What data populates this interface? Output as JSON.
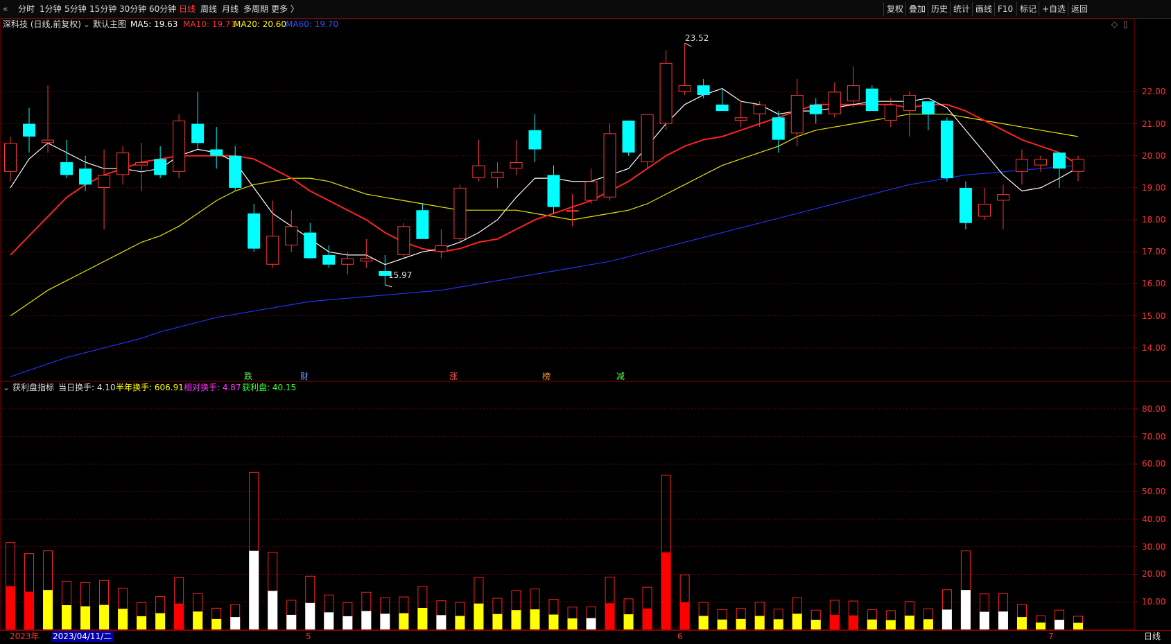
{
  "toolbar": {
    "collapse_icon": "double-chevron-left-icon",
    "periods": [
      "分时",
      "1分钟",
      "5分钟",
      "15分钟",
      "30分钟",
      "60分钟",
      "日线",
      "周线",
      "月线",
      "多周期",
      "更多 〉"
    ],
    "active_period": "日线",
    "right_buttons": [
      "复权",
      "叠加",
      "历史",
      "统计",
      "画线",
      "F10",
      "标记",
      "+自选",
      "返回"
    ]
  },
  "main_chart": {
    "title": "深科技 (日线,前复权)",
    "chart_icon": "circle-chevron-down-icon",
    "theme_label": "默认主图",
    "ma": [
      {
        "label": "MA5: 19.63",
        "color": "#ffffff"
      },
      {
        "label": "MA10: 19.71",
        "color": "#ff3333"
      },
      {
        "label": "MA20: 20.60",
        "color": "#ffff00"
      },
      {
        "label": "MA60: 19.70",
        "color": "#2244ff"
      }
    ],
    "right_icons": [
      "diamond-icon",
      "window-icon"
    ],
    "high_label": "23.52",
    "low_label": "15.97",
    "event_labels": [
      {
        "text": "跌",
        "color": "#55ff55"
      },
      {
        "text": "财",
        "color": "#6699ff"
      },
      {
        "text": "涨",
        "color": "#ff5555"
      },
      {
        "text": "榜",
        "color": "#ff9933"
      },
      {
        "text": "减",
        "color": "#55ff55"
      }
    ],
    "y_ticks": [
      "22.00",
      "21.00",
      "20.00",
      "19.00",
      "18.00",
      "17.00",
      "16.00",
      "15.00",
      "14.00"
    ]
  },
  "indicator": {
    "title": "获利盘指标",
    "stats": [
      {
        "label": "当日换手: 4.10",
        "color": "#dddddd"
      },
      {
        "label": "半年换手: 606.91",
        "color": "#ffff00"
      },
      {
        "label": "相对换手: 4.87",
        "color": "#ff33ff"
      },
      {
        "label": "获利盘: 40.15",
        "color": "#33ff33"
      }
    ],
    "y_ticks": [
      "80.00",
      "70.00",
      "60.00",
      "50.00",
      "40.00",
      "30.00",
      "20.00",
      "10.00"
    ]
  },
  "x_axis": {
    "year_label": "2023年",
    "date_label": "2023/04/11/二",
    "month_marks": [
      "5",
      "6",
      "7"
    ],
    "period_tab": "日线"
  },
  "chart_data": {
    "type": "candlestick",
    "candles": [
      {
        "o": 19.5,
        "h": 20.6,
        "l": 19.2,
        "c": 20.4
      },
      {
        "o": 21.0,
        "h": 21.5,
        "l": 20.1,
        "c": 20.6
      },
      {
        "o": 20.4,
        "h": 22.2,
        "l": 20.1,
        "c": 20.5
      },
      {
        "o": 19.8,
        "h": 20.5,
        "l": 19.3,
        "c": 19.4
      },
      {
        "o": 19.6,
        "h": 20.0,
        "l": 18.9,
        "c": 19.1
      },
      {
        "o": 19.0,
        "h": 20.2,
        "l": 17.7,
        "c": 19.4
      },
      {
        "o": 19.4,
        "h": 20.3,
        "l": 19.1,
        "c": 20.1
      },
      {
        "o": 19.7,
        "h": 20.4,
        "l": 18.9,
        "c": 19.8
      },
      {
        "o": 19.9,
        "h": 20.3,
        "l": 19.3,
        "c": 19.4
      },
      {
        "o": 19.5,
        "h": 21.3,
        "l": 19.3,
        "c": 21.1
      },
      {
        "o": 21.0,
        "h": 22.0,
        "l": 20.2,
        "c": 20.4
      },
      {
        "o": 20.2,
        "h": 20.9,
        "l": 19.6,
        "c": 20.0
      },
      {
        "o": 20.0,
        "h": 20.3,
        "l": 18.9,
        "c": 19.0
      },
      {
        "o": 18.2,
        "h": 18.5,
        "l": 17.0,
        "c": 17.1
      },
      {
        "o": 16.6,
        "h": 18.6,
        "l": 16.5,
        "c": 17.5
      },
      {
        "o": 17.2,
        "h": 18.3,
        "l": 17.0,
        "c": 17.8
      },
      {
        "o": 17.6,
        "h": 17.9,
        "l": 16.8,
        "c": 16.8
      },
      {
        "o": 16.9,
        "h": 17.2,
        "l": 16.5,
        "c": 16.6
      },
      {
        "o": 16.6,
        "h": 17.0,
        "l": 16.3,
        "c": 16.8
      },
      {
        "o": 16.7,
        "h": 17.4,
        "l": 16.5,
        "c": 16.8
      },
      {
        "o": 16.4,
        "h": 16.9,
        "l": 15.97,
        "c": 16.25
      },
      {
        "o": 16.9,
        "h": 17.9,
        "l": 16.8,
        "c": 17.8
      },
      {
        "o": 18.3,
        "h": 18.5,
        "l": 17.4,
        "c": 17.4
      },
      {
        "o": 17.0,
        "h": 17.7,
        "l": 16.8,
        "c": 17.2
      },
      {
        "o": 17.4,
        "h": 19.1,
        "l": 17.3,
        "c": 19.0
      },
      {
        "o": 19.3,
        "h": 20.5,
        "l": 19.2,
        "c": 19.7
      },
      {
        "o": 19.3,
        "h": 19.8,
        "l": 19.0,
        "c": 19.5
      },
      {
        "o": 19.6,
        "h": 20.5,
        "l": 19.4,
        "c": 19.8
      },
      {
        "o": 20.8,
        "h": 21.3,
        "l": 19.8,
        "c": 20.2
      },
      {
        "o": 19.4,
        "h": 19.7,
        "l": 18.2,
        "c": 18.4
      },
      {
        "o": 18.3,
        "h": 18.8,
        "l": 17.8,
        "c": 18.3
      },
      {
        "o": 18.6,
        "h": 19.6,
        "l": 18.5,
        "c": 19.2
      },
      {
        "o": 18.7,
        "h": 21.0,
        "l": 18.6,
        "c": 20.7
      },
      {
        "o": 21.1,
        "h": 21.1,
        "l": 20.0,
        "c": 20.1
      },
      {
        "o": 19.8,
        "h": 21.3,
        "l": 19.6,
        "c": 21.3
      },
      {
        "o": 21.0,
        "h": 23.3,
        "l": 20.8,
        "c": 22.9
      },
      {
        "o": 22.0,
        "h": 23.52,
        "l": 21.9,
        "c": 22.2
      },
      {
        "o": 22.2,
        "h": 22.4,
        "l": 21.8,
        "c": 21.9
      },
      {
        "o": 21.6,
        "h": 22.1,
        "l": 21.4,
        "c": 21.4
      },
      {
        "o": 21.1,
        "h": 21.7,
        "l": 20.9,
        "c": 21.2
      },
      {
        "o": 21.3,
        "h": 21.7,
        "l": 20.9,
        "c": 21.6
      },
      {
        "o": 21.2,
        "h": 21.4,
        "l": 20.1,
        "c": 20.5
      },
      {
        "o": 20.7,
        "h": 22.4,
        "l": 20.3,
        "c": 21.9
      },
      {
        "o": 21.6,
        "h": 21.8,
        "l": 21.0,
        "c": 21.3
      },
      {
        "o": 21.3,
        "h": 22.3,
        "l": 21.2,
        "c": 22.0
      },
      {
        "o": 21.7,
        "h": 22.8,
        "l": 21.5,
        "c": 22.2
      },
      {
        "o": 22.1,
        "h": 22.2,
        "l": 21.4,
        "c": 21.4
      },
      {
        "o": 21.1,
        "h": 21.8,
        "l": 20.9,
        "c": 21.6
      },
      {
        "o": 21.4,
        "h": 22.0,
        "l": 20.6,
        "c": 21.9
      },
      {
        "o": 21.7,
        "h": 21.7,
        "l": 20.8,
        "c": 21.3
      },
      {
        "o": 21.1,
        "h": 21.2,
        "l": 19.2,
        "c": 19.3
      },
      {
        "o": 19.0,
        "h": 19.2,
        "l": 17.7,
        "c": 17.9
      },
      {
        "o": 18.1,
        "h": 19.0,
        "l": 18.0,
        "c": 18.5
      },
      {
        "o": 18.6,
        "h": 19.1,
        "l": 17.7,
        "c": 18.8
      },
      {
        "o": 19.5,
        "h": 20.2,
        "l": 19.1,
        "c": 19.9
      },
      {
        "o": 19.7,
        "h": 20.0,
        "l": 19.5,
        "c": 19.9
      },
      {
        "o": 20.1,
        "h": 20.1,
        "l": 19.0,
        "c": 19.6
      },
      {
        "o": 19.5,
        "h": 20.0,
        "l": 19.2,
        "c": 19.9
      }
    ],
    "ma5": [
      19.0,
      19.9,
      20.4,
      20.1,
      19.8,
      19.6,
      19.6,
      19.5,
      19.6,
      20.0,
      20.2,
      20.1,
      19.8,
      19.0,
      18.2,
      17.8,
      17.4,
      17.0,
      16.9,
      16.9,
      16.6,
      16.8,
      17.0,
      17.1,
      17.3,
      17.6,
      18.0,
      18.7,
      19.3,
      19.3,
      19.2,
      19.2,
      19.4,
      19.6,
      20.3,
      21.0,
      21.6,
      21.9,
      22.1,
      21.7,
      21.6,
      21.3,
      21.4,
      21.4,
      21.5,
      21.6,
      21.7,
      21.7,
      21.7,
      21.8,
      21.5,
      20.8,
      20.1,
      19.4,
      18.9,
      19.0,
      19.3,
      19.63
    ],
    "ma10": [
      16.9,
      17.5,
      18.1,
      18.7,
      19.1,
      19.4,
      19.6,
      19.8,
      19.9,
      20.0,
      20.0,
      20.0,
      20.0,
      19.9,
      19.6,
      19.3,
      18.9,
      18.6,
      18.3,
      18.0,
      17.6,
      17.3,
      17.1,
      17.0,
      17.1,
      17.3,
      17.4,
      17.7,
      18.0,
      18.2,
      18.4,
      18.6,
      18.9,
      19.2,
      19.6,
      20.0,
      20.3,
      20.5,
      20.6,
      20.8,
      21.0,
      21.2,
      21.4,
      21.6,
      21.6,
      21.6,
      21.6,
      21.6,
      21.5,
      21.6,
      21.6,
      21.4,
      21.1,
      20.8,
      20.5,
      20.3,
      20.1,
      19.71
    ],
    "ma20": [
      15.0,
      15.4,
      15.8,
      16.1,
      16.4,
      16.7,
      17.0,
      17.3,
      17.5,
      17.8,
      18.2,
      18.6,
      18.9,
      19.1,
      19.2,
      19.3,
      19.3,
      19.2,
      19.0,
      18.8,
      18.7,
      18.6,
      18.5,
      18.4,
      18.3,
      18.3,
      18.3,
      18.3,
      18.2,
      18.1,
      18.0,
      18.1,
      18.2,
      18.3,
      18.5,
      18.8,
      19.1,
      19.4,
      19.7,
      19.9,
      20.1,
      20.3,
      20.6,
      20.8,
      20.9,
      21.0,
      21.1,
      21.2,
      21.3,
      21.3,
      21.3,
      21.2,
      21.1,
      21.0,
      20.9,
      20.8,
      20.7,
      20.6
    ],
    "ma60": [
      13.1,
      13.3,
      13.5,
      13.7,
      13.85,
      14.0,
      14.15,
      14.3,
      14.5,
      14.65,
      14.8,
      14.95,
      15.05,
      15.15,
      15.25,
      15.35,
      15.45,
      15.5,
      15.55,
      15.6,
      15.65,
      15.7,
      15.75,
      15.8,
      15.9,
      16.0,
      16.1,
      16.2,
      16.3,
      16.4,
      16.5,
      16.6,
      16.7,
      16.85,
      17.0,
      17.15,
      17.3,
      17.45,
      17.6,
      17.75,
      17.9,
      18.05,
      18.2,
      18.35,
      18.5,
      18.65,
      18.8,
      18.95,
      19.1,
      19.2,
      19.3,
      19.4,
      19.45,
      19.5,
      19.55,
      19.6,
      19.65,
      19.7
    ],
    "profit_bars": [
      {
        "t": 31.5,
        "v": 15.7,
        "c": "red"
      },
      {
        "t": 27.5,
        "v": 13.7,
        "c": "red"
      },
      {
        "t": 28.5,
        "v": 14.3,
        "c": "yellow"
      },
      {
        "t": 17.5,
        "v": 8.8,
        "c": "yellow"
      },
      {
        "t": 17.0,
        "v": 8.4,
        "c": "yellow"
      },
      {
        "t": 17.8,
        "v": 8.9,
        "c": "yellow"
      },
      {
        "t": 15.0,
        "v": 7.5,
        "c": "yellow"
      },
      {
        "t": 9.7,
        "v": 4.8,
        "c": "yellow"
      },
      {
        "t": 11.9,
        "v": 5.9,
        "c": "yellow"
      },
      {
        "t": 18.8,
        "v": 9.4,
        "c": "red"
      },
      {
        "t": 13.0,
        "v": 6.5,
        "c": "yellow"
      },
      {
        "t": 7.7,
        "v": 3.8,
        "c": "yellow"
      },
      {
        "t": 9.0,
        "v": 4.5,
        "c": "white"
      },
      {
        "t": 57.0,
        "v": 28.5,
        "c": "white"
      },
      {
        "t": 28.0,
        "v": 14.0,
        "c": "white"
      },
      {
        "t": 10.6,
        "v": 5.3,
        "c": "white"
      },
      {
        "t": 19.3,
        "v": 9.6,
        "c": "white"
      },
      {
        "t": 12.5,
        "v": 6.2,
        "c": "white"
      },
      {
        "t": 9.7,
        "v": 4.8,
        "c": "white"
      },
      {
        "t": 13.5,
        "v": 6.7,
        "c": "white"
      },
      {
        "t": 11.5,
        "v": 5.7,
        "c": "white"
      },
      {
        "t": 11.8,
        "v": 5.9,
        "c": "yellow"
      },
      {
        "t": 15.6,
        "v": 7.8,
        "c": "yellow"
      },
      {
        "t": 10.4,
        "v": 5.2,
        "c": "white"
      },
      {
        "t": 9.8,
        "v": 4.9,
        "c": "yellow"
      },
      {
        "t": 18.9,
        "v": 9.4,
        "c": "yellow"
      },
      {
        "t": 11.3,
        "v": 5.6,
        "c": "yellow"
      },
      {
        "t": 14.1,
        "v": 7.0,
        "c": "yellow"
      },
      {
        "t": 14.7,
        "v": 7.3,
        "c": "yellow"
      },
      {
        "t": 10.9,
        "v": 5.4,
        "c": "yellow"
      },
      {
        "t": 8.1,
        "v": 4.0,
        "c": "yellow"
      },
      {
        "t": 8.2,
        "v": 4.1,
        "c": "white"
      },
      {
        "t": 19.0,
        "v": 9.5,
        "c": "red"
      },
      {
        "t": 11.1,
        "v": 5.5,
        "c": "yellow"
      },
      {
        "t": 15.3,
        "v": 7.6,
        "c": "red"
      },
      {
        "t": 56.0,
        "v": 28.0,
        "c": "red"
      },
      {
        "t": 19.8,
        "v": 9.9,
        "c": "red"
      },
      {
        "t": 9.8,
        "v": 4.9,
        "c": "yellow"
      },
      {
        "t": 7.2,
        "v": 3.6,
        "c": "yellow"
      },
      {
        "t": 7.6,
        "v": 3.8,
        "c": "yellow"
      },
      {
        "t": 9.9,
        "v": 4.9,
        "c": "yellow"
      },
      {
        "t": 7.4,
        "v": 3.7,
        "c": "yellow"
      },
      {
        "t": 11.5,
        "v": 5.7,
        "c": "yellow"
      },
      {
        "t": 7.0,
        "v": 3.5,
        "c": "yellow"
      },
      {
        "t": 10.6,
        "v": 5.3,
        "c": "red"
      },
      {
        "t": 10.3,
        "v": 5.1,
        "c": "red"
      },
      {
        "t": 7.2,
        "v": 3.6,
        "c": "yellow"
      },
      {
        "t": 6.8,
        "v": 3.4,
        "c": "yellow"
      },
      {
        "t": 10.1,
        "v": 5.0,
        "c": "yellow"
      },
      {
        "t": 7.5,
        "v": 3.7,
        "c": "yellow"
      },
      {
        "t": 14.4,
        "v": 7.2,
        "c": "white"
      },
      {
        "t": 28.5,
        "v": 14.3,
        "c": "white"
      },
      {
        "t": 12.9,
        "v": 6.4,
        "c": "white"
      },
      {
        "t": 13.0,
        "v": 6.5,
        "c": "white"
      },
      {
        "t": 9.0,
        "v": 4.5,
        "c": "yellow"
      },
      {
        "t": 5.0,
        "v": 2.5,
        "c": "yellow"
      },
      {
        "t": 7.0,
        "v": 3.5,
        "c": "white"
      },
      {
        "t": 4.8,
        "v": 2.4,
        "c": "yellow"
      }
    ],
    "price_ylim": [
      13.0,
      24.0
    ],
    "indicator_ylim": [
      0,
      85
    ],
    "colors": {
      "up": "#ff3b3b",
      "down": "#00ffff",
      "ma5": "#ffffff",
      "ma10": "#ff2222",
      "ma20": "#e6e600",
      "ma60": "#2233ee",
      "grid": "#6b0000",
      "bar_red": "#ff0000",
      "bar_yellow": "#ffff00",
      "bar_white": "#ffffff"
    }
  }
}
